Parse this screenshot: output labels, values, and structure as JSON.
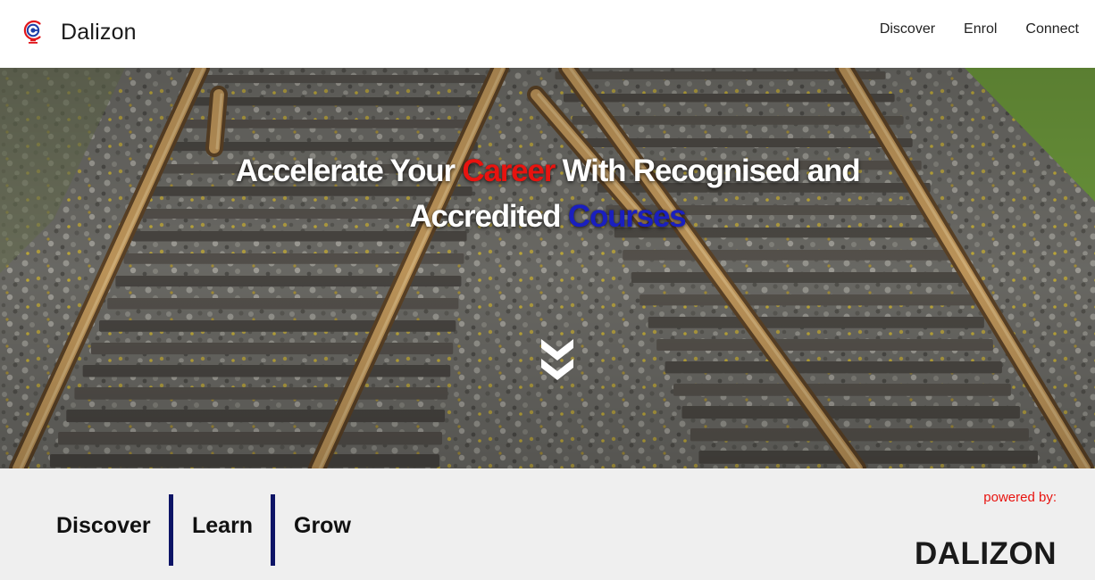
{
  "header": {
    "brand": "Dalizon",
    "logo_icon": "globe-icon",
    "nav": [
      "Discover",
      "Enrol",
      "Connect"
    ]
  },
  "hero": {
    "title_line1_a": "Accelerate Your ",
    "title_line1_highlight": "Career",
    "title_line1_b": " With Recognised and",
    "title_line2_a": "Accredited ",
    "title_line2_highlight": "Courses",
    "highlight1_color": "#e8130f",
    "highlight2_color": "#1a1fbf",
    "background": "railway-tracks-photo",
    "scroll_icon": "double-chevron-down-icon"
  },
  "band": {
    "pillars": [
      "Discover",
      "Learn",
      "Grow"
    ],
    "powered_label": "powered by:",
    "powered_brand": "DALIZON",
    "divider_color": "#0d1466",
    "powered_color": "#e8130f"
  }
}
